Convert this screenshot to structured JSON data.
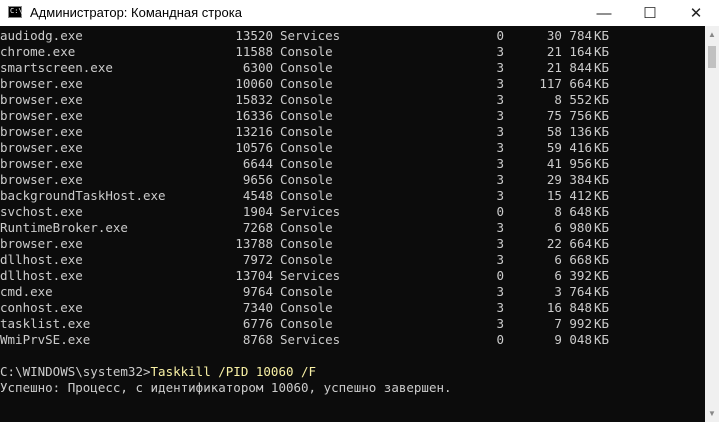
{
  "window": {
    "icon_text": "C:\\",
    "title": "Администратор: Командная строка",
    "minimize_glyph": "—",
    "maximize_glyph": "☐",
    "close_glyph": "✕"
  },
  "processes": [
    {
      "name": "audiodg.exe",
      "pid": "13520",
      "session": "Services",
      "num": "0",
      "mem": "30 784",
      "unit": "КБ"
    },
    {
      "name": "chrome.exe",
      "pid": "11588",
      "session": "Console",
      "num": "3",
      "mem": "21 164",
      "unit": "КБ"
    },
    {
      "name": "smartscreen.exe",
      "pid": "6300",
      "session": "Console",
      "num": "3",
      "mem": "21 844",
      "unit": "КБ"
    },
    {
      "name": "browser.exe",
      "pid": "10060",
      "session": "Console",
      "num": "3",
      "mem": "117 664",
      "unit": "КБ"
    },
    {
      "name": "browser.exe",
      "pid": "15832",
      "session": "Console",
      "num": "3",
      "mem": "8 552",
      "unit": "КБ"
    },
    {
      "name": "browser.exe",
      "pid": "16336",
      "session": "Console",
      "num": "3",
      "mem": "75 756",
      "unit": "КБ"
    },
    {
      "name": "browser.exe",
      "pid": "13216",
      "session": "Console",
      "num": "3",
      "mem": "58 136",
      "unit": "КБ"
    },
    {
      "name": "browser.exe",
      "pid": "10576",
      "session": "Console",
      "num": "3",
      "mem": "59 416",
      "unit": "КБ"
    },
    {
      "name": "browser.exe",
      "pid": "6644",
      "session": "Console",
      "num": "3",
      "mem": "41 956",
      "unit": "КБ"
    },
    {
      "name": "browser.exe",
      "pid": "9656",
      "session": "Console",
      "num": "3",
      "mem": "29 384",
      "unit": "КБ"
    },
    {
      "name": "backgroundTaskHost.exe",
      "pid": "4548",
      "session": "Console",
      "num": "3",
      "mem": "15 412",
      "unit": "КБ"
    },
    {
      "name": "svchost.exe",
      "pid": "1904",
      "session": "Services",
      "num": "0",
      "mem": "8 648",
      "unit": "КБ"
    },
    {
      "name": "RuntimeBroker.exe",
      "pid": "7268",
      "session": "Console",
      "num": "3",
      "mem": "6 980",
      "unit": "КБ"
    },
    {
      "name": "browser.exe",
      "pid": "13788",
      "session": "Console",
      "num": "3",
      "mem": "22 664",
      "unit": "КБ"
    },
    {
      "name": "dllhost.exe",
      "pid": "7972",
      "session": "Console",
      "num": "3",
      "mem": "6 668",
      "unit": "КБ"
    },
    {
      "name": "dllhost.exe",
      "pid": "13704",
      "session": "Services",
      "num": "0",
      "mem": "6 392",
      "unit": "КБ"
    },
    {
      "name": "cmd.exe",
      "pid": "9764",
      "session": "Console",
      "num": "3",
      "mem": "3 764",
      "unit": "КБ"
    },
    {
      "name": "conhost.exe",
      "pid": "7340",
      "session": "Console",
      "num": "3",
      "mem": "16 848",
      "unit": "КБ"
    },
    {
      "name": "tasklist.exe",
      "pid": "6776",
      "session": "Console",
      "num": "3",
      "mem": "7 992",
      "unit": "КБ"
    },
    {
      "name": "WmiPrvSE.exe",
      "pid": "8768",
      "session": "Services",
      "num": "0",
      "mem": "9 048",
      "unit": "КБ"
    }
  ],
  "prompt": {
    "path": "C:\\WINDOWS\\system32>",
    "command": "Taskkill /PID 10060 /F"
  },
  "result": "Успешно: Процесс, с идентификатором 10060, успешно завершен.",
  "colors": {
    "console_bg": "#0c0c0c",
    "console_text": "#cccccc",
    "command_text": "#f9f1a5"
  },
  "icons": {
    "app": "cmd-icon",
    "scroll_up": "chevron-up-icon",
    "scroll_down": "chevron-down-icon"
  }
}
